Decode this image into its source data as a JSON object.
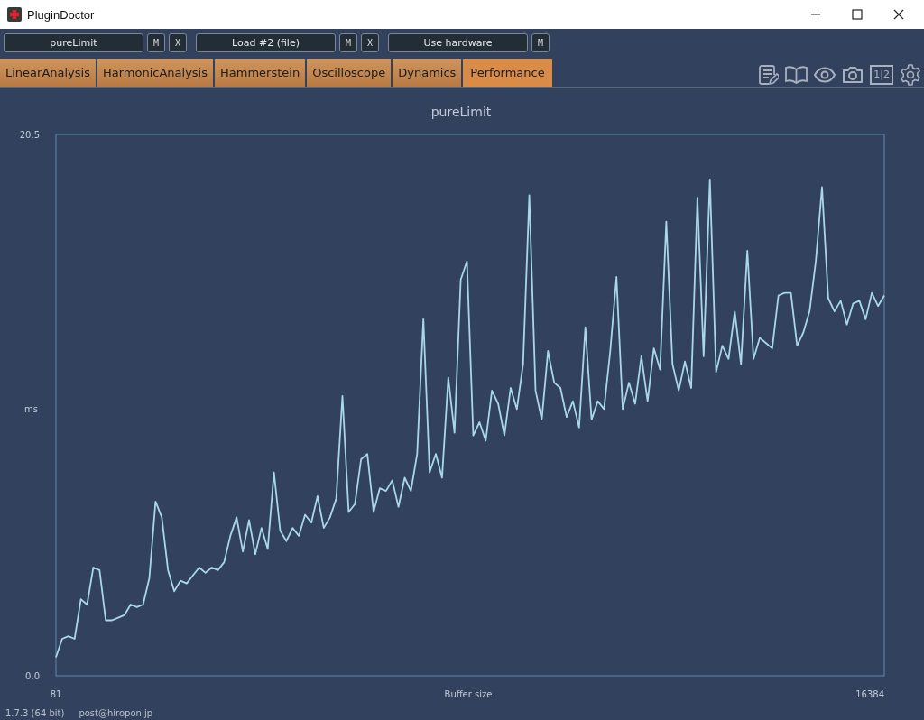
{
  "window": {
    "title": "PluginDoctor"
  },
  "slots": [
    {
      "label": "pureLimit",
      "buttons": [
        "M",
        "X"
      ]
    },
    {
      "label": "Load #2 (file)",
      "buttons": [
        "M",
        "X"
      ]
    },
    {
      "label": "Use hardware",
      "buttons": [
        "M"
      ]
    }
  ],
  "tabs": [
    {
      "label": "LinearAnalysis",
      "selected": false
    },
    {
      "label": "HarmonicAnalysis",
      "selected": false
    },
    {
      "label": "Hammerstein",
      "selected": false
    },
    {
      "label": "Oscilloscope",
      "selected": false
    },
    {
      "label": "Dynamics",
      "selected": false
    },
    {
      "label": "Performance",
      "selected": true
    }
  ],
  "toolbar": {
    "compare_label": "1|2"
  },
  "chart": {
    "x_axis_start": "81",
    "x_axis_end": "16384",
    "chart_data": {
      "type": "line",
      "title": "pureLimit",
      "xlabel": "Buffer size",
      "ylabel": "ms",
      "ylim": [
        0,
        20.5
      ],
      "yticks": [
        {
          "value": 0,
          "label": "0.0"
        },
        20.5
      ],
      "series": [
        {
          "color": "#a8d8e8",
          "values": [
            0.7,
            1.4,
            1.5,
            1.4,
            2.9,
            2.7,
            4.1,
            4.0,
            2.1,
            2.1,
            2.2,
            2.3,
            2.7,
            2.6,
            2.7,
            3.7,
            6.6,
            6.0,
            4.0,
            3.2,
            3.6,
            3.5,
            3.8,
            4.1,
            3.9,
            4.1,
            4.0,
            4.3,
            5.3,
            6.0,
            4.7,
            5.9,
            4.6,
            5.6,
            4.8,
            7.7,
            5.5,
            5.1,
            5.6,
            5.3,
            6.1,
            5.8,
            6.8,
            5.6,
            6.0,
            6.7,
            10.6,
            6.2,
            6.5,
            8.2,
            8.4,
            6.2,
            7.1,
            7.0,
            7.4,
            6.4,
            7.5,
            7.0,
            8.4,
            13.5,
            7.7,
            8.4,
            7.5,
            11.3,
            9.2,
            15.0,
            15.7,
            9.1,
            9.6,
            8.9,
            10.8,
            10.3,
            9.1,
            10.9,
            10.1,
            11.8,
            18.2,
            10.8,
            9.7,
            12.3,
            11.1,
            10.9,
            9.8,
            10.4,
            9.4,
            13.2,
            9.7,
            10.4,
            10.1,
            12.3,
            15.1,
            10.1,
            11.1,
            10.3,
            12.1,
            10.4,
            12.4,
            11.6,
            17.2,
            11.8,
            10.8,
            11.9,
            10.9,
            18.1,
            12.1,
            18.8,
            11.5,
            12.5,
            12.0,
            13.8,
            11.8,
            16.1,
            12.0,
            12.8,
            12.6,
            12.4,
            14.4,
            14.5,
            14.5,
            12.5,
            13.0,
            13.8,
            15.7,
            18.5,
            14.3,
            13.8,
            14.2,
            13.3,
            14.1,
            14.2,
            13.5,
            14.5,
            14.0,
            14.4
          ]
        }
      ]
    }
  },
  "footer": {
    "version": "1.7.3 (64 bit)",
    "email": "post@hiropon.jp"
  }
}
